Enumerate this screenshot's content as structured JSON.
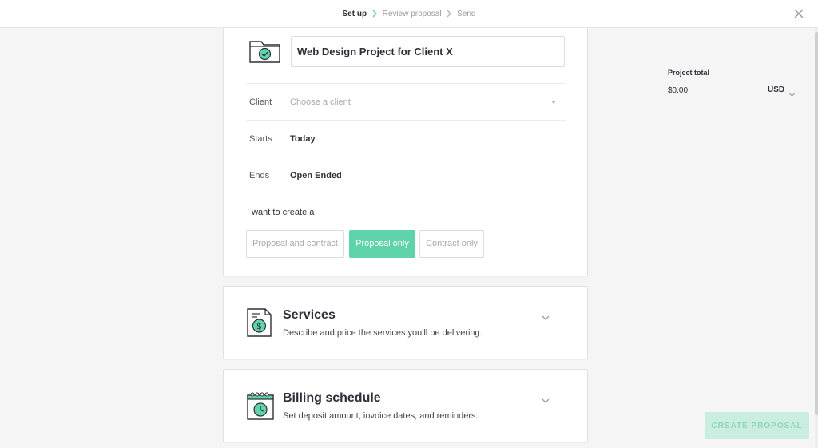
{
  "steps": {
    "setup": "Set up",
    "review": "Review proposal",
    "send": "Send"
  },
  "project": {
    "name": "Web Design Project for Client X"
  },
  "fields": {
    "client_label": "Client",
    "client_placeholder": "Choose a client",
    "starts_label": "Starts",
    "starts_value": "Today",
    "ends_label": "Ends",
    "ends_value": "Open Ended"
  },
  "create_type": {
    "label": "I want to create a",
    "options": [
      "Proposal and contract",
      "Proposal only",
      "Contract only"
    ],
    "selected": "Proposal only"
  },
  "sections": {
    "services": {
      "title": "Services",
      "description": "Describe and price the services you'll be delivering."
    },
    "billing": {
      "title": "Billing schedule",
      "description": "Set deposit amount, invoice dates, and reminders."
    }
  },
  "summary": {
    "label": "Project total",
    "value": "$0.00",
    "currency": "USD"
  },
  "actions": {
    "create": "CREATE PROPOSAL"
  },
  "colors": {
    "accent": "#5fd3a9",
    "accent_light": "#c9eee0",
    "text": "#2f2f3a"
  }
}
